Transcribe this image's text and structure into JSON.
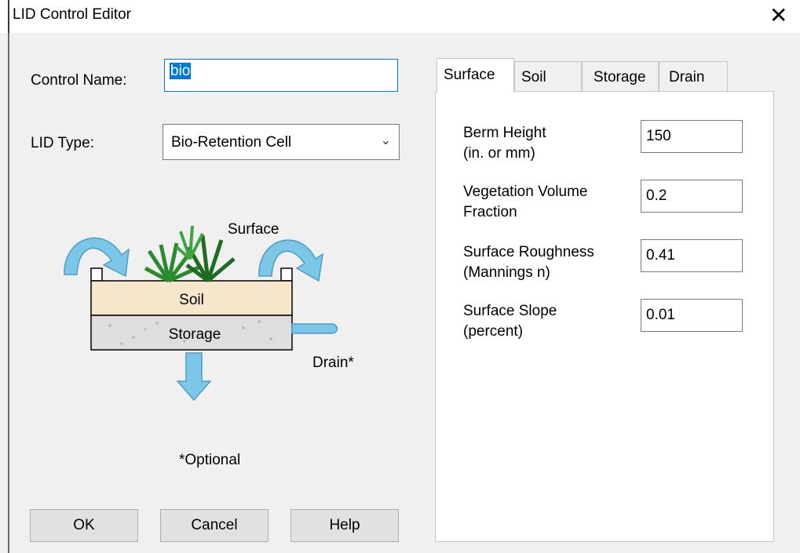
{
  "window": {
    "title": "LID Control Editor",
    "close_symbol": "✕"
  },
  "form": {
    "control_name_label": "Control Name:",
    "control_name_value": "bio",
    "lid_type_label": "LID Type:",
    "lid_type_value": "Bio-Retention Cell"
  },
  "diagram": {
    "surface": "Surface",
    "soil": "Soil",
    "storage": "Storage",
    "drain": "Drain*",
    "optional": "*Optional"
  },
  "tabs": [
    {
      "label": "Surface",
      "active": true
    },
    {
      "label": "Soil",
      "active": false
    },
    {
      "label": "Storage",
      "active": false
    },
    {
      "label": "Drain",
      "active": false
    }
  ],
  "surface_fields": [
    {
      "label_line1": "Berm Height",
      "label_line2": "(in. or mm)",
      "value": "150"
    },
    {
      "label_line1": "Vegetation Volume",
      "label_line2": "Fraction",
      "value": "0.2"
    },
    {
      "label_line1": "Surface Roughness",
      "label_line2": "(Mannings n)",
      "value": "0.41"
    },
    {
      "label_line1": "Surface Slope",
      "label_line2": "(percent)",
      "value": "0.01"
    }
  ],
  "buttons": {
    "ok": "OK",
    "cancel": "Cancel",
    "help": "Help"
  },
  "colors": {
    "accent": "#0078d7",
    "arrow": "#7cc7e8",
    "soil": "#f5e6cc"
  }
}
